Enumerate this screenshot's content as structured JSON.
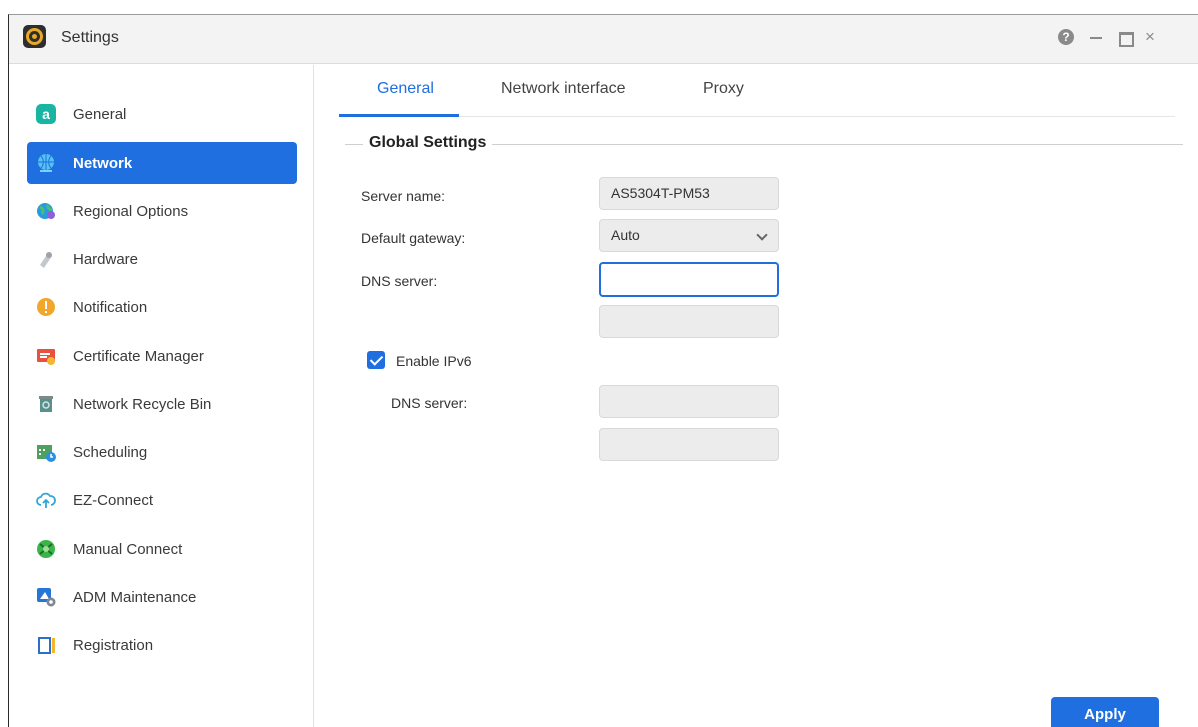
{
  "app": {
    "title": "Settings"
  },
  "window_controls": {
    "help": "?",
    "close": "×"
  },
  "sidebar": {
    "items": [
      {
        "label": "General",
        "icon": "general-icon",
        "color": "#1ab5a2"
      },
      {
        "label": "Network",
        "icon": "network-globe-icon",
        "color": "#31a9e8",
        "active": true
      },
      {
        "label": "Regional Options",
        "icon": "regional-globe-icon",
        "color": "#2a9ae0"
      },
      {
        "label": "Hardware",
        "icon": "hardware-icon",
        "color": "#b9bcc4"
      },
      {
        "label": "Notification",
        "icon": "notification-icon",
        "color": "#f2a72c"
      },
      {
        "label": "Certificate Manager",
        "icon": "certificate-icon",
        "color": "#e9513f"
      },
      {
        "label": "Network Recycle Bin",
        "icon": "recycle-bin-icon",
        "color": "#5b8f8c"
      },
      {
        "label": "Scheduling",
        "icon": "scheduling-icon",
        "color": "#4f9f5f"
      },
      {
        "label": "EZ-Connect",
        "icon": "cloud-upload-icon",
        "color": "#2fa7d9"
      },
      {
        "label": "Manual Connect",
        "icon": "manual-connect-icon",
        "color": "#3bb54a"
      },
      {
        "label": "ADM Maintenance",
        "icon": "adm-maintenance-icon",
        "color": "#2576d6"
      },
      {
        "label": "Registration",
        "icon": "registration-icon",
        "color": "#2a6fc9"
      }
    ]
  },
  "tabs": [
    {
      "label": "General",
      "active": true
    },
    {
      "label": "Network interface"
    },
    {
      "label": "Proxy"
    }
  ],
  "global_settings": {
    "title": "Global Settings",
    "server_name_label": "Server name:",
    "server_name_value": "AS5304T-PM53",
    "default_gateway_label": "Default gateway:",
    "default_gateway_value": "Auto",
    "dns_server_label": "DNS server:",
    "dns_primary_value": "",
    "dns_secondary_value": "",
    "enable_ipv6_label": "Enable IPv6",
    "enable_ipv6_checked": true,
    "ipv6_dns_server_label": "DNS server:",
    "ipv6_dns_primary_value": "",
    "ipv6_dns_secondary_value": ""
  },
  "actions": {
    "apply_label": "Apply"
  },
  "colors": {
    "accent": "#1f6fe0"
  }
}
